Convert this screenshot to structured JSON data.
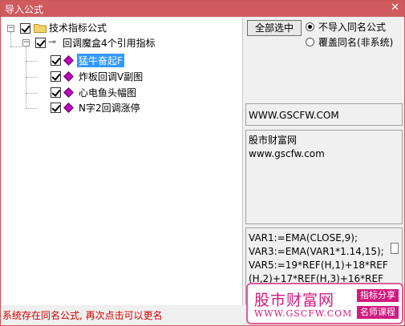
{
  "window": {
    "title": "导入公式",
    "close_glyph": "✕"
  },
  "tree": {
    "root_expander": "−",
    "root_label": "技术指标公式",
    "group_expander": "−",
    "group_label": "回调魔盒4个引用指标",
    "items": [
      {
        "label": "猛牛奋起F",
        "selected": true
      },
      {
        "label": "炸板回调V副图",
        "selected": false
      },
      {
        "label": "心电鱼头幅图",
        "selected": false
      },
      {
        "label": "N字2回调涨停",
        "selected": false
      }
    ]
  },
  "options": {
    "select_all_label": "全部选中",
    "radio_skip_label": "不导入同名公式",
    "radio_overwrite_label": "覆盖同名(非系统)",
    "selected_radio": "skip"
  },
  "info": {
    "url_box": "WWW.GSCFW.COM",
    "desc_lines": [
      "股市财富网",
      "www.gscfw.com"
    ],
    "code_lines": [
      "VAR1:=EMA(CLOSE,9);",
      "VAR3:=EMA(VAR1*1.14,15);",
      "VAR5:=19*REF(H,1)+18*REF",
      "(H,2)+17*REF(H,3)+16*REF"
    ]
  },
  "status": {
    "message": "系统存在同名公式, 再次点击可以更名"
  },
  "watermark": {
    "name": "股市财富网",
    "url": "WWW.GSCFW.COM",
    "tag1": "指标分享",
    "tag2": "名师课程"
  },
  "colors": {
    "titlebar": "#cf5b5e",
    "status_text": "#d00000",
    "selection": "#3399ff",
    "brand": "#d01a80"
  }
}
